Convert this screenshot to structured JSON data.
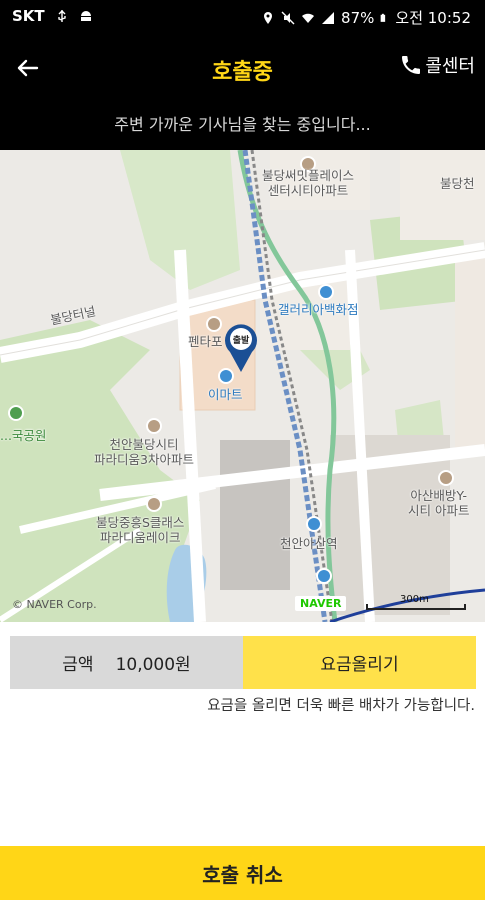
{
  "status_bar": {
    "carrier": "SKT",
    "battery": "87%",
    "time": "오전 10:52",
    "icons": [
      "usb-icon",
      "android-icon",
      "location-icon",
      "mute-icon",
      "wifi-icon",
      "signal-icon",
      "battery-icon"
    ]
  },
  "header": {
    "title": "호출중",
    "callcenter_label": "콜센터",
    "back_icon": "arrow-left-icon",
    "phone_icon": "phone-icon",
    "title_color": "#ffd617"
  },
  "subheader": {
    "message": "주변 가까운 기사님을 찾는 중입니다..."
  },
  "map": {
    "labels": {
      "bulldang_summit": "불당써밋플레이스\n센터시티아파트",
      "bulldang_cheon": "불당천",
      "bulldang_tunnel": "불당터널",
      "galleria": "갤러리아백화점",
      "pentaport": "펜타포",
      "emart": "이마트",
      "park": "...국공원",
      "paradium3": "천안불당시티\n파라디움3차아파트",
      "asan_y": "아산배방Y-\n시티 아파트",
      "paradium_lake": "불당중흥S클래스\n파라디움레이크",
      "station": "천안아산역"
    },
    "marker_label": "출발",
    "copyright": "© NAVER Corp.",
    "brand": "NAVER",
    "scale": "300m"
  },
  "fare": {
    "label": "금액",
    "amount": "10,000원",
    "raise_button": "요금올리기",
    "hint": "요금을 올리면 더욱 빠른 배차가 가능합니다."
  },
  "cancel_button": "호출 취소",
  "colors": {
    "accent_yellow": "#ffd617",
    "raise_yellow": "#ffe14a",
    "fare_gray": "#d9d9d9"
  }
}
